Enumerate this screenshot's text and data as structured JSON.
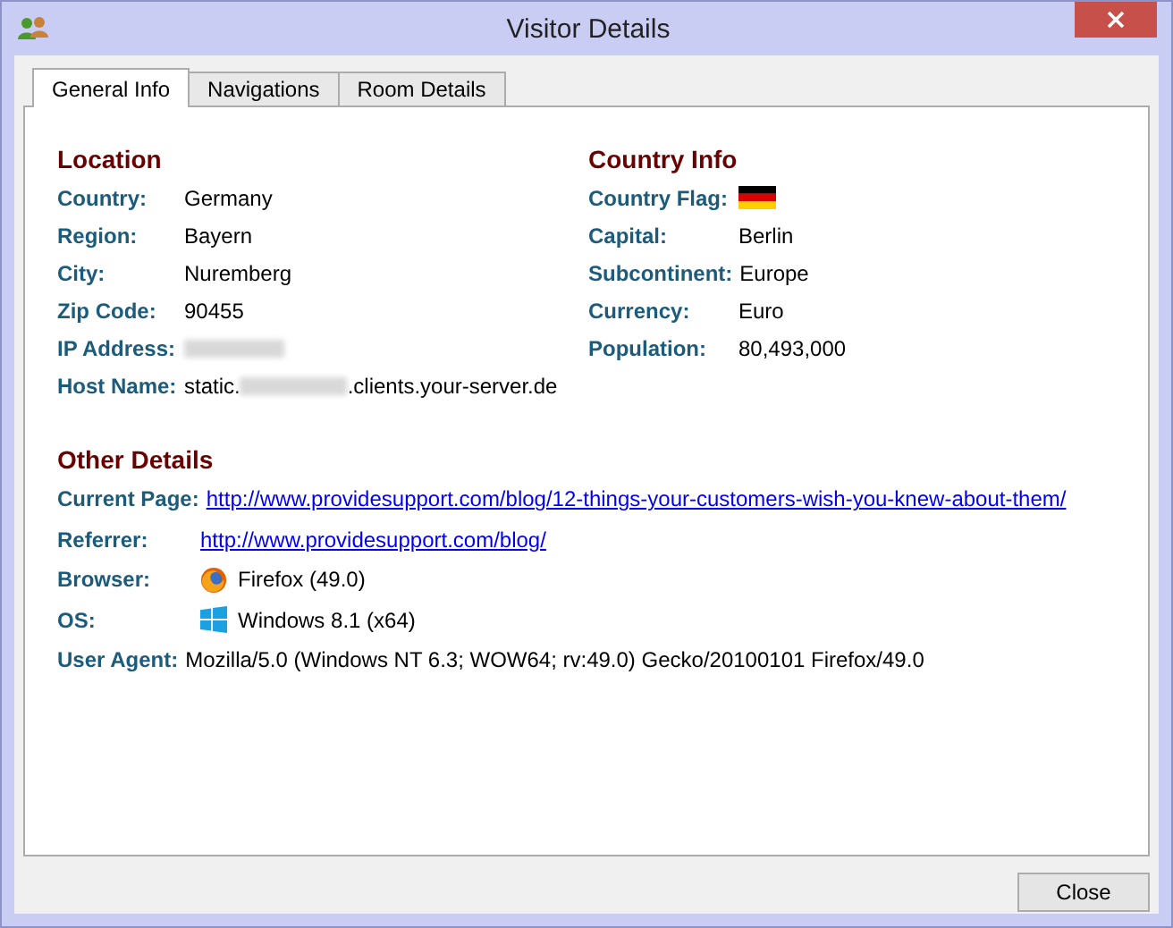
{
  "window": {
    "title": "Visitor Details"
  },
  "tabs": [
    {
      "label": "General Info",
      "selected": true
    },
    {
      "label": "Navigations",
      "selected": false
    },
    {
      "label": "Room Details",
      "selected": false
    }
  ],
  "location": {
    "heading": "Location",
    "rows": [
      {
        "kind": "text",
        "label": "Country:",
        "value": "Germany"
      },
      {
        "kind": "text",
        "label": "Region:",
        "value": "Bayern"
      },
      {
        "kind": "text",
        "label": "City:",
        "value": "Nuremberg"
      },
      {
        "kind": "text",
        "label": "Zip Code:",
        "value": "90455"
      },
      {
        "kind": "redacted",
        "label": "IP Address:"
      },
      {
        "kind": "redacted_middle",
        "label": "Host Name:",
        "prefix": "static.",
        "suffix": ".clients.your-server.de"
      }
    ]
  },
  "country_info": {
    "heading": "Country Info",
    "rows": [
      {
        "kind": "flag",
        "label": "Country Flag:"
      },
      {
        "kind": "text",
        "label": "Capital:",
        "value": "Berlin"
      },
      {
        "kind": "text",
        "label": "Subcontinent:",
        "value": "Europe"
      },
      {
        "kind": "text",
        "label": "Currency:",
        "value": "Euro"
      },
      {
        "kind": "text",
        "label": "Population:",
        "value": "80,493,000"
      }
    ]
  },
  "other_details": {
    "heading": "Other Details",
    "rows": [
      {
        "kind": "link",
        "label": "Current Page:",
        "value": "http://www.providesupport.com/blog/12-things-your-customers-wish-you-knew-about-them/"
      },
      {
        "kind": "link",
        "label": "Referrer:",
        "value": "http://www.providesupport.com/blog/"
      },
      {
        "kind": "browser",
        "label": "Browser:",
        "value": "Firefox (49.0)"
      },
      {
        "kind": "os",
        "label": "OS:",
        "value": "Windows 8.1 (x64)"
      },
      {
        "kind": "text",
        "label": "User Agent:",
        "value": "Mozilla/5.0 (Windows NT 6.3; WOW64; rv:49.0) Gecko/20100101 Firefox/49.0"
      }
    ]
  },
  "buttons": [
    {
      "label": "Close"
    }
  ]
}
